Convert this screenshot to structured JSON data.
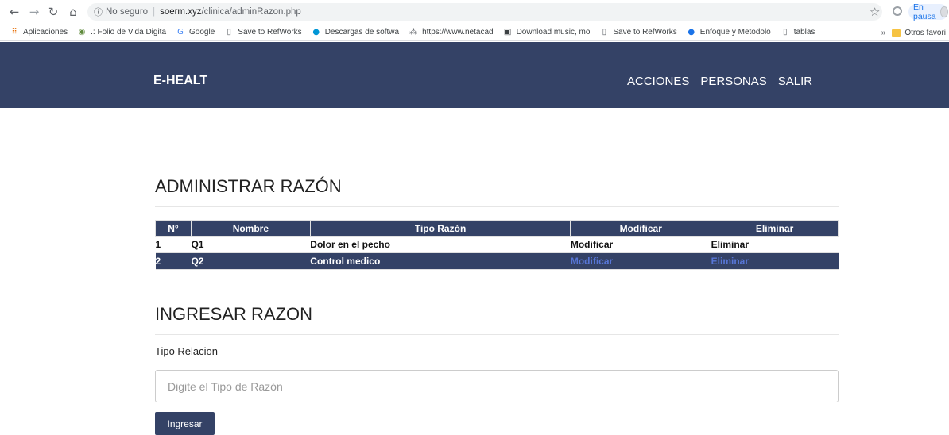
{
  "browser": {
    "secure_label": "No seguro",
    "url_host": "soerm.xyz",
    "url_path": "/clinica/adminRazon.php",
    "paused_label": "En pausa",
    "bookmarks": [
      {
        "icon": "apps-grid-icon",
        "glyph": "⠿",
        "label": "Aplicaciones"
      },
      {
        "icon": "globe-icon",
        "glyph": "◉",
        "label": ".: Folio de Vida Digita"
      },
      {
        "icon": "google-icon",
        "glyph": "G",
        "label": "Google"
      },
      {
        "icon": "page-icon",
        "glyph": "▯",
        "label": "Save to RefWorks"
      },
      {
        "icon": "hp-icon",
        "glyph": "●",
        "label": "Descargas de softwa"
      },
      {
        "icon": "netacad-icon",
        "glyph": "⁂",
        "label": "https://www.netacad"
      },
      {
        "icon": "music-icon",
        "glyph": "▣",
        "label": "Download music, mo"
      },
      {
        "icon": "page-icon",
        "glyph": "▯",
        "label": "Save to RefWorks"
      },
      {
        "icon": "book-icon",
        "glyph": "●",
        "label": "Enfoque y Metodolo"
      },
      {
        "icon": "page-icon",
        "glyph": "▯",
        "label": "tablas"
      }
    ],
    "more_label": "»",
    "other_bookmarks": "Otros favori"
  },
  "header": {
    "brand": "E-HEALT",
    "nav": [
      "ACCIONES",
      "PERSONAS",
      "SALIR"
    ]
  },
  "admin": {
    "title": "ADMINISTRAR RAZÓN",
    "columns": [
      "N°",
      "Nombre",
      "Tipo Razón",
      "Modificar",
      "Eliminar"
    ],
    "rows": [
      {
        "num": "1",
        "nombre": "Q1",
        "tipo": "Dolor en el pecho",
        "modificar": "Modificar",
        "eliminar": "Eliminar"
      },
      {
        "num": "2",
        "nombre": "Q2",
        "tipo": "Control medico",
        "modificar": "Modificar",
        "eliminar": "Eliminar"
      }
    ]
  },
  "form": {
    "title": "INGRESAR RAZON",
    "label": "Tipo Relacion",
    "placeholder": "Digite el Tipo de Razón",
    "submit": "Ingresar"
  },
  "colors": {
    "primary": "#344266",
    "link": "#4a6fd8"
  }
}
